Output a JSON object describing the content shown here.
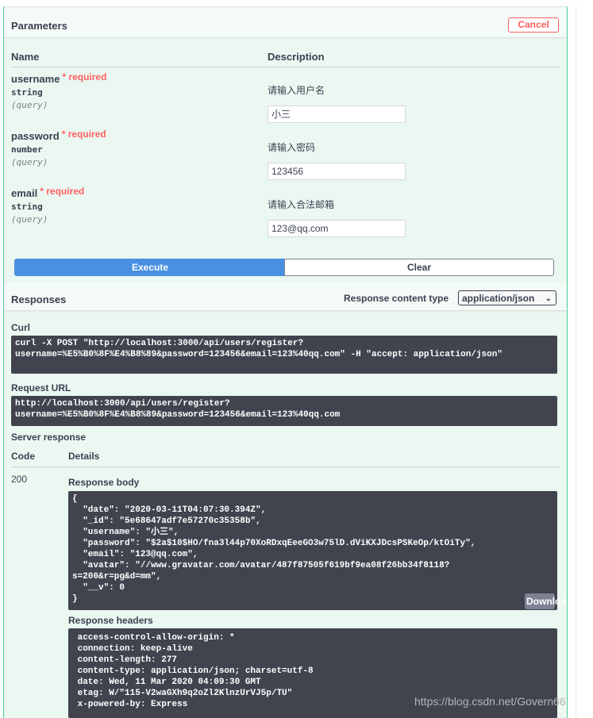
{
  "parameters": {
    "title": "Parameters",
    "cancel_label": "Cancel",
    "col_name": "Name",
    "col_description": "Description",
    "items": [
      {
        "name": "username",
        "required": "* required",
        "type": "string",
        "in": "(query)",
        "description": "请输入用户名",
        "value": "小三"
      },
      {
        "name": "password",
        "required": "* required",
        "type": "number",
        "in": "(query)",
        "description": "请输入密码",
        "value": "123456"
      },
      {
        "name": "email",
        "required": "* required",
        "type": "string",
        "in": "(query)",
        "description": "请输入合法邮箱",
        "value": "123@qq.com"
      }
    ],
    "execute_label": "Execute",
    "clear_label": "Clear"
  },
  "responses": {
    "title": "Responses",
    "content_type_label": "Response content type",
    "content_type_value": "application/json",
    "curl_label": "Curl",
    "curl": "curl -X POST \"http://localhost:3000/api/users/register?\nusername=%E5%B0%8F%E4%B8%89&password=123456&email=123%40qq.com\" -H \"accept: application/json\"",
    "request_url_label": "Request URL",
    "request_url": "http://localhost:3000/api/users/register?\nusername=%E5%B0%8F%E4%B8%89&password=123456&email=123%40qq.com",
    "server_response_label": "Server response",
    "col_code": "Code",
    "col_details": "Details",
    "code": "200",
    "body_label": "Response body",
    "body": "{\n  \"date\": \"2020-03-11T04:07:30.394Z\",\n  \"_id\": \"5e68647adf7e57270c35358b\",\n  \"username\": \"小三\",\n  \"password\": \"$2a$10$HO/fna3l44p70XoRDxqEeeGO3w75lD.dViKXJDcsPSKeOp/ktOiTy\",\n  \"email\": \"123@qq.com\",\n  \"avatar\": \"//www.gravatar.com/avatar/487f87505f619bf9ea08f26bb34f8118?\ns=200&r=pg&d=mm\",\n  \"__v\": 0\n}",
    "download_label": "Download",
    "headers_label": "Response headers",
    "headers": " access-control-allow-origin: *\n connection: keep-alive\n content-length: 277\n content-type: application/json; charset=utf-8\n date: Wed, 11 Mar 2020 04:09:30 GMT\n etag: W/\"115-V2waGXh9q2oZl2KlnzUrVJ5p/TU\"\n x-powered-by: Express"
  },
  "watermark": "https://blog.csdn.net/Govern66",
  "colors": {
    "panel_bg": "#ebf7f1",
    "border": "#49cc90",
    "execute": "#4990e2",
    "code_bg": "#41444e",
    "required": "#ff6060"
  }
}
